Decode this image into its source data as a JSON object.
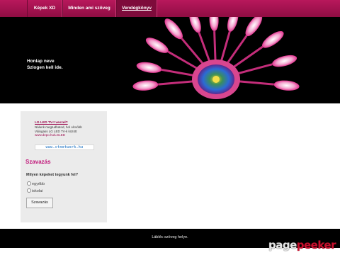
{
  "nav": {
    "items": [
      {
        "label": "Képek XD",
        "active": false
      },
      {
        "label": "Minden ami szöveg",
        "active": false
      },
      {
        "label": "Vendégkönyv",
        "active": true
      }
    ]
  },
  "header": {
    "site_name": "Honlap neve",
    "slogan": "Szlogen kell ide."
  },
  "sidebar": {
    "ad": {
      "title": "LG LED TV-t veszel?",
      "line1": "Nálunk megtudhatod, hol olcsóbb",
      "line2": "Válogass LG LED TV-k között",
      "url": "www.depo.hu/LGLED"
    },
    "banner": "www.ctnetwork.hu",
    "poll": {
      "heading": "Szavazás",
      "question": "Milyen képeket tegyunk fel?",
      "options": [
        "egyébb",
        "iskolai"
      ],
      "submit_label": "Szavazás"
    }
  },
  "footer": {
    "text": "Lábléc szöveg helye."
  },
  "watermark": {
    "part1": "page",
    "part2": "peeker"
  },
  "colors": {
    "nav_bg": "#a5124f",
    "accent": "#c0187a",
    "header_bg": "#000000",
    "sidebar_bg": "#ebebeb"
  }
}
